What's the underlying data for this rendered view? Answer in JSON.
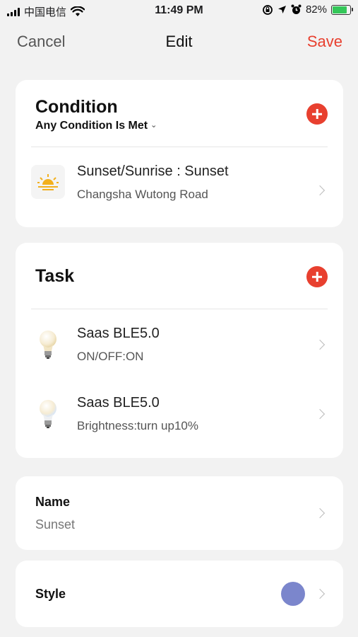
{
  "status_bar": {
    "carrier": "中国电信",
    "time": "11:49 PM",
    "battery_percent": "82%",
    "battery_level": 0.82
  },
  "nav": {
    "cancel": "Cancel",
    "title": "Edit",
    "save": "Save"
  },
  "condition": {
    "title": "Condition",
    "mode": "Any Condition Is Met",
    "items": [
      {
        "title": "Sunset/Sunrise : Sunset",
        "detail": "Changsha Wutong Road",
        "icon": "sunset-icon"
      }
    ]
  },
  "task": {
    "title": "Task",
    "items": [
      {
        "title": "Saas BLE5.0",
        "detail": "ON/OFF:ON",
        "icon": "bulb-icon"
      },
      {
        "title": "Saas BLE5.0",
        "detail": "Brightness:turn up10%",
        "icon": "bulb-icon"
      }
    ]
  },
  "name": {
    "label": "Name",
    "value": "Sunset"
  },
  "style": {
    "label": "Style",
    "color": "#7b86cc"
  },
  "colors": {
    "accent": "#e8402f",
    "background": "#f2f2f2"
  }
}
